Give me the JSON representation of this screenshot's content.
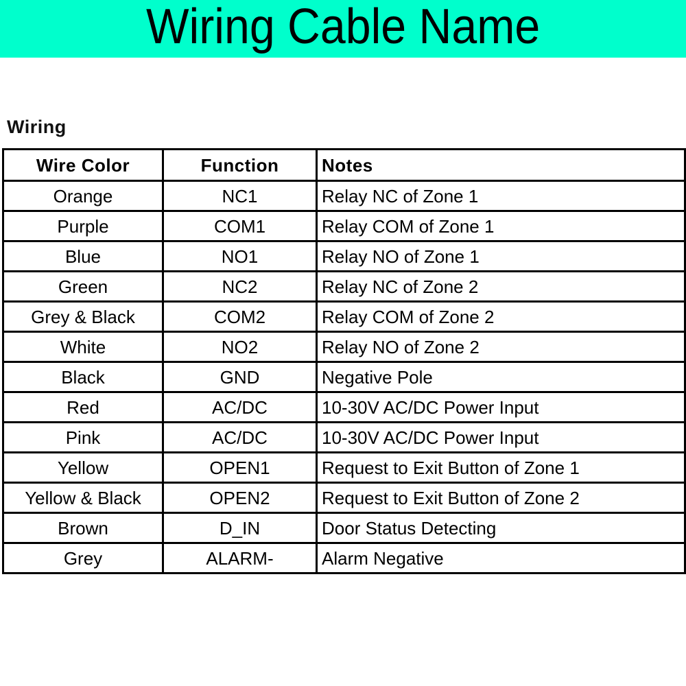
{
  "banner": {
    "title": "Wiring Cable Name",
    "background_color": "#00ffcc",
    "text_color": "#000000"
  },
  "section": {
    "heading": "Wiring"
  },
  "table": {
    "columns": [
      "Wire Color",
      "Function",
      "Notes"
    ],
    "rows": [
      {
        "wire_color": "Orange",
        "function": "NC1",
        "notes": "Relay NC of Zone 1"
      },
      {
        "wire_color": "Purple",
        "function": "COM1",
        "notes": "Relay COM of Zone 1"
      },
      {
        "wire_color": "Blue",
        "function": "NO1",
        "notes": "Relay NO of Zone 1"
      },
      {
        "wire_color": "Green",
        "function": "NC2",
        "notes": "Relay NC of Zone 2"
      },
      {
        "wire_color": "Grey  &  Black",
        "function": "COM2",
        "notes": "Relay COM of Zone 2"
      },
      {
        "wire_color": "White",
        "function": "NO2",
        "notes": "Relay NO of Zone 2"
      },
      {
        "wire_color": "Black",
        "function": "GND",
        "notes": "Negative Pole"
      },
      {
        "wire_color": "Red",
        "function": "AC/DC",
        "notes": "10-30V AC/DC Power Input"
      },
      {
        "wire_color": "Pink",
        "function": "AC/DC",
        "notes": "10-30V AC/DC Power Input"
      },
      {
        "wire_color": "Yellow",
        "function": "OPEN1",
        "notes": "Request to Exit Button of Zone 1"
      },
      {
        "wire_color": "Yellow & Black",
        "function": "OPEN2",
        "notes": "Request to Exit Button of Zone 2"
      },
      {
        "wire_color": "Brown",
        "function": "D_IN",
        "notes": "Door Status Detecting"
      },
      {
        "wire_color": "Grey",
        "function": "ALARM-",
        "notes": "Alarm Negative"
      }
    ]
  }
}
